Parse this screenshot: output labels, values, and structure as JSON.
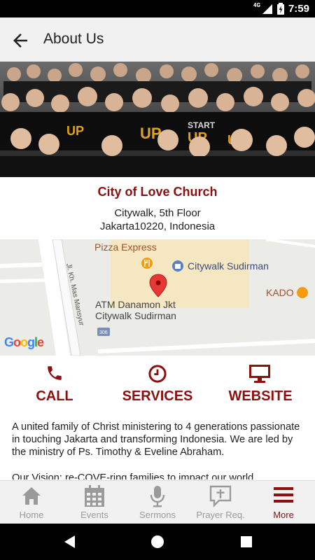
{
  "status": {
    "network": "4G",
    "time": "7:59"
  },
  "appbar": {
    "title": "About Us"
  },
  "church": {
    "name": "City of Love Church",
    "address_line1": "Citywalk, 5th Floor",
    "address_line2": "Jakarta10220, Indonesia"
  },
  "map": {
    "poi_pizza": "Pizza Express",
    "poi_citywalk": "Citywalk Sudirman",
    "poi_kado": "KADO",
    "poi_atm_line1": "ATM Danamon Jkt",
    "poi_atm_line2": "Citywalk Sudirman",
    "street": "Jl. Kh. Mas Mansyur",
    "road_badge": "306",
    "google": "Google"
  },
  "actions": {
    "call_label": "CALL",
    "services_label": "SERVICES",
    "website_label": "WEBSITE"
  },
  "description": {
    "paragraph1": "A united family of Christ ministering to 4 generations passionate in touching Jakarta and transforming Indonesia. We are led by the ministry of Ps. Timothy & Eveline Abraham.",
    "paragraph2": "Our Vision: re-COVE-ring families to impact our world."
  },
  "bottomnav": {
    "home": "Home",
    "events": "Events",
    "sermons": "Sermons",
    "prayer": "Prayer Req.",
    "more": "More"
  },
  "colors": {
    "accent": "#8b1010",
    "nav_inactive": "#9a9a9a"
  }
}
